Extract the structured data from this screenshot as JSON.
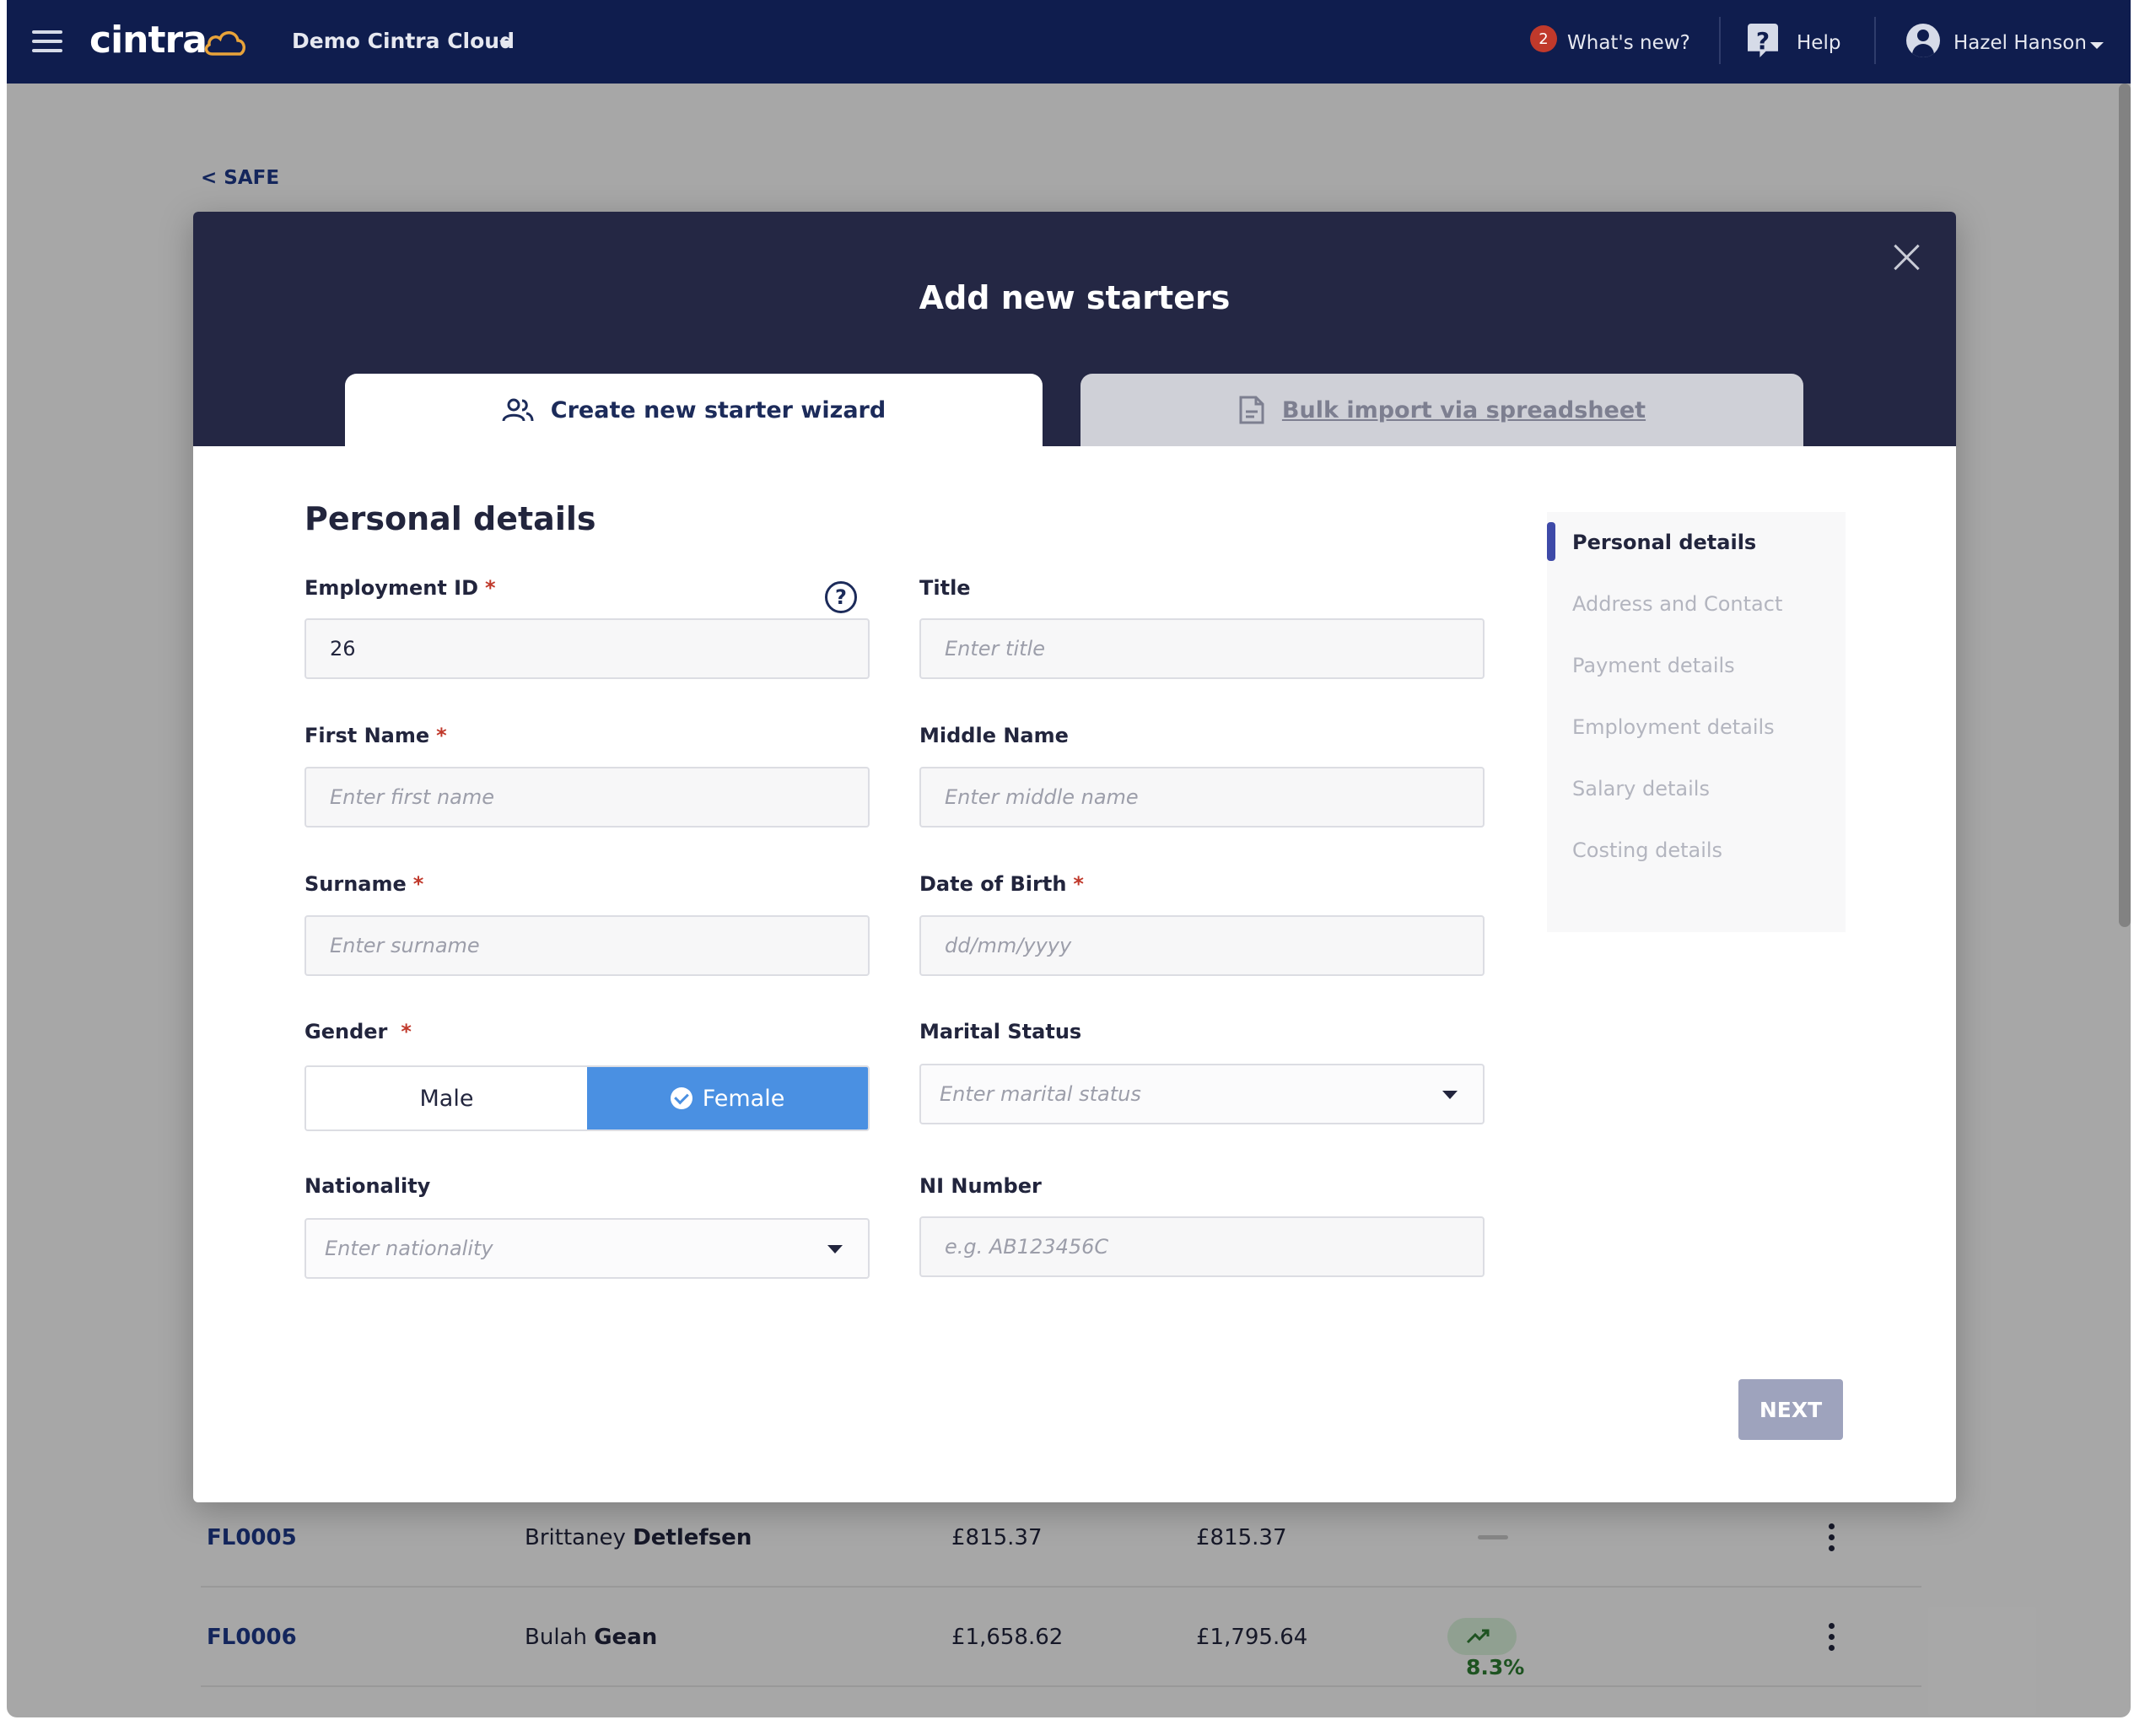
{
  "topbar": {
    "logo": "cintra",
    "tenant": "Demo Cintra Cloud",
    "whats_new_count": "2",
    "whats_new": "What's new?",
    "help": "Help",
    "user": "Hazel Hanson"
  },
  "back_link": "< SAFE",
  "background_rows": [
    {
      "id": "FL0005",
      "first": "Brittaney",
      "last": "Detlefsen",
      "amount1": "£815.37",
      "amount2": "£815.37",
      "change": ""
    },
    {
      "id": "FL0006",
      "first": "Bulah",
      "last": "Gean",
      "amount1": "£1,658.62",
      "amount2": "£1,795.64",
      "change": "8.3%"
    }
  ],
  "modal": {
    "title": "Add new starters",
    "tabs": {
      "wizard": "Create new starter wizard",
      "bulk": "Bulk import via spreadsheet"
    },
    "section_title": "Personal details",
    "fields": {
      "employment_id": {
        "label": "Employment ID",
        "value": "26"
      },
      "title": {
        "label": "Title",
        "placeholder": "Enter title"
      },
      "first_name": {
        "label": "First Name",
        "placeholder": "Enter first name"
      },
      "middle_name": {
        "label": "Middle Name",
        "placeholder": "Enter middle name"
      },
      "surname": {
        "label": "Surname",
        "placeholder": "Enter surname"
      },
      "dob": {
        "label": "Date of Birth",
        "placeholder": "dd/mm/yyyy"
      },
      "gender": {
        "label": "Gender",
        "options": [
          "Male",
          "Female"
        ],
        "selected": "Female"
      },
      "marital_status": {
        "label": "Marital Status",
        "placeholder": "Enter marital status"
      },
      "nationality": {
        "label": "Nationality",
        "placeholder": "Enter nationality"
      },
      "ni_number": {
        "label": "NI Number",
        "placeholder": "e.g. AB123456C"
      }
    },
    "required_mark": "*",
    "steps": [
      "Personal details",
      "Address and Contact",
      "Payment details",
      "Employment details",
      "Salary details",
      "Costing details"
    ],
    "next_button": "NEXT"
  },
  "colors": {
    "topbar": "#0f1d4e",
    "modal_header": "#242744",
    "selected_gender": "#4a90e2",
    "step_active_bar": "#3e4aa8",
    "next_button": "#9ea3bd"
  }
}
